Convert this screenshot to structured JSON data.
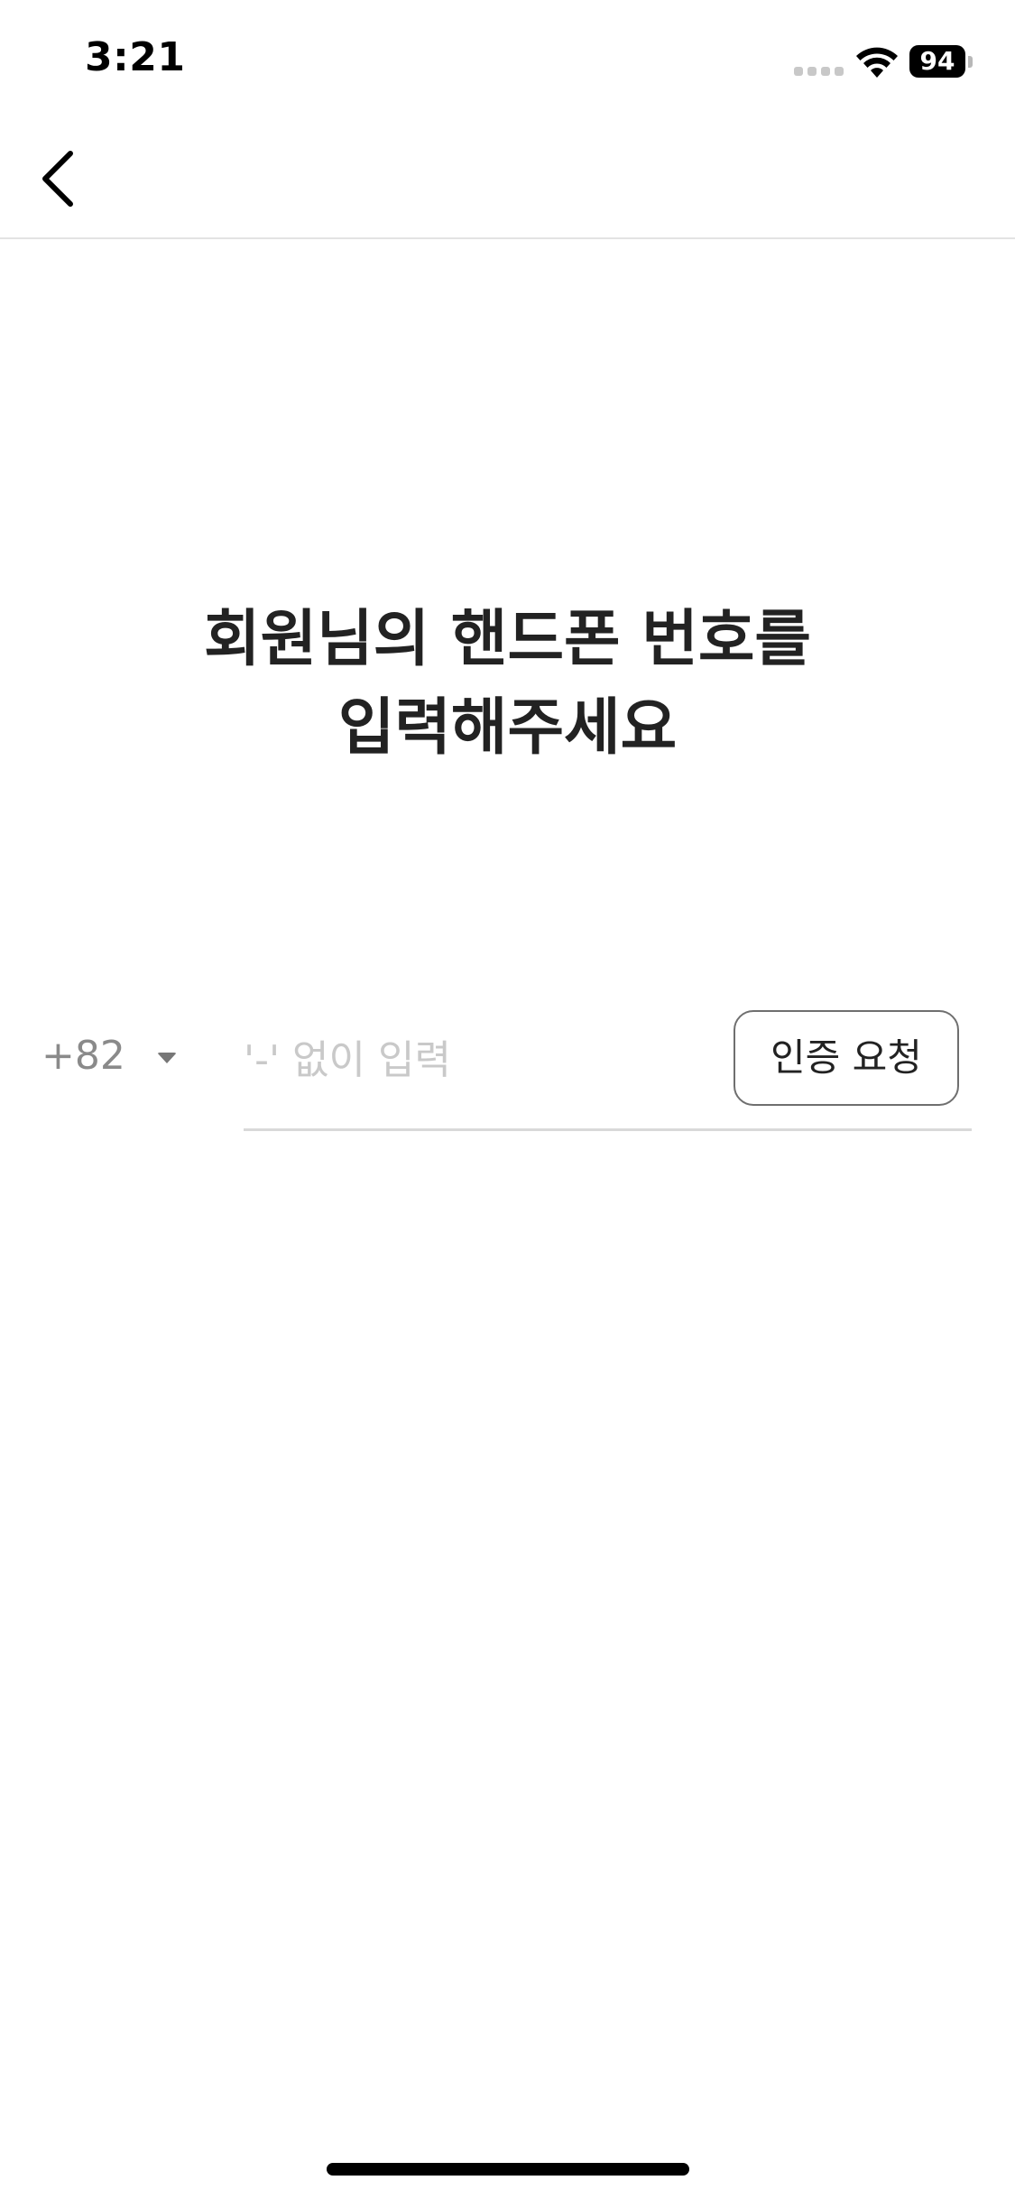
{
  "status_bar": {
    "time": "3:21",
    "battery_level": "94",
    "icons": [
      "cellular-signal-icon",
      "wifi-icon",
      "battery-icon"
    ]
  },
  "nav": {
    "back_icon": "chevron-left-icon"
  },
  "headline": {
    "line1": "회원님의 핸드폰 번호를",
    "line2": "입력해주세요"
  },
  "phone_form": {
    "country_code": "+82",
    "country_dropdown_icon": "caret-down-icon",
    "phone_value": "",
    "phone_placeholder": "'-' 없이 입력",
    "verify_button_label": "인증 요청"
  },
  "colors": {
    "text_primary": "#222222",
    "text_muted": "#8a8a8a",
    "placeholder": "#c9c9c9",
    "divider": "#e3e3e3",
    "button_border": "#6f6f6f"
  }
}
